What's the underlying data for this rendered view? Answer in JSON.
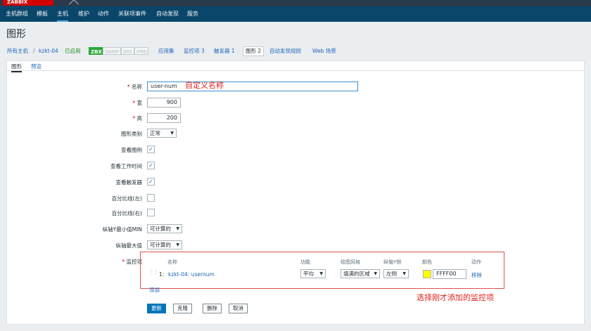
{
  "logo": {
    "text": "ZABBIX"
  },
  "topnav": {
    "items": [
      "主机群组",
      "模板",
      "主机",
      "维护",
      "动作",
      "关联项事件",
      "自动发现",
      "服务"
    ],
    "active_index": 2
  },
  "page": {
    "title": "图形"
  },
  "hostnav": {
    "all_hosts": "所有主机",
    "separator": "/",
    "host": "kzkt-04",
    "status": "已启用",
    "badges": [
      "ZBX",
      "SNMP",
      "JMX",
      "IPMI"
    ],
    "applications": "应用集",
    "items": "监控项 3",
    "triggers": "触发器 1",
    "graphs": "图形 2",
    "discovery": "自动发现规则",
    "web": "Web 场景"
  },
  "tabs": {
    "graph": "图形",
    "preview": "预览"
  },
  "form": {
    "required_mark": "*",
    "name_label": "名称",
    "name_value": "user-num",
    "width_label": "宽",
    "width_value": "900",
    "height_label": "高",
    "height_value": "200",
    "graph_type_label": "图形类别",
    "graph_type_value": "正常",
    "show_legend_label": "查看图例",
    "show_working_time_label": "查看工作时间",
    "show_triggers_label": "查看触发器",
    "percentile_left_label": "百分比线(左)",
    "percentile_right_label": "百分比线(右)",
    "ymin_label": "纵轴Y最小值MIN",
    "ymin_value": "可计算的",
    "ymax_label": "纵轴最大值",
    "ymax_value": "可计算的",
    "items_label": "监控项",
    "checkbox_states": {
      "show_legend": true,
      "show_working_time": true,
      "show_triggers": true,
      "percentile_left": false,
      "percentile_right": false
    }
  },
  "items_table": {
    "headers": {
      "name": "名称",
      "function": "功能",
      "draw_style": "绘图风格",
      "y_axis_side": "纵轴Y侧",
      "colour": "颜色",
      "action": "动作"
    },
    "rows": [
      {
        "index": "1:",
        "name": "kzkt-04: usernum",
        "function": "平均",
        "draw_style": "填满的区域",
        "y_axis_side": "左侧",
        "colour": "FFFF00",
        "action": "移除"
      }
    ],
    "add_link": "添加"
  },
  "buttons": {
    "update": "更新",
    "clone": "克隆",
    "delete": "删除",
    "cancel": "取消"
  },
  "annotations": {
    "name_note": "自定义名称",
    "items_note": "选择刚才添加的监控项"
  },
  "colors": {
    "header_bg": "#0a466a",
    "logo_red": "#d40000",
    "link_blue": "#1f65b8",
    "enabled_green": "#1f8f1f",
    "annotation_red": "#e02020",
    "swatch": "#FFFF00",
    "primary_button": "#0275b8"
  }
}
